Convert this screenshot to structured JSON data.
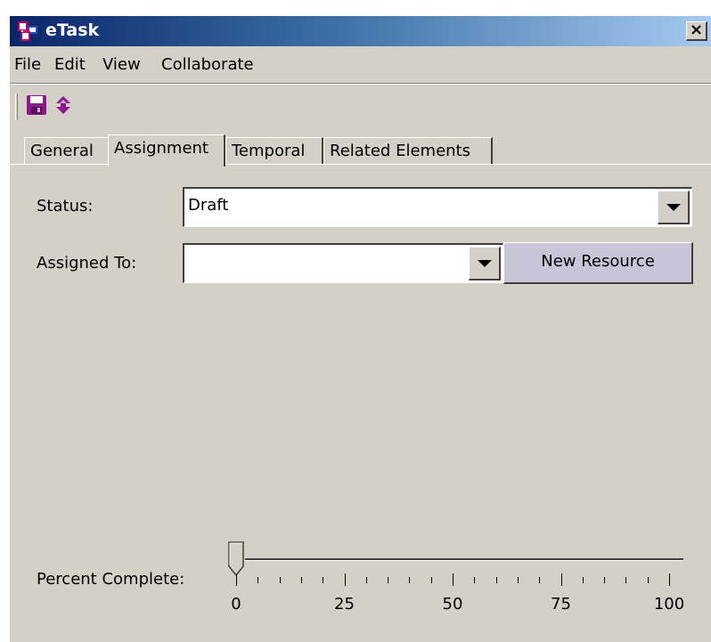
{
  "window": {
    "title": "eTask",
    "close_glyph": "×"
  },
  "menu": {
    "items": [
      {
        "label": "File"
      },
      {
        "label": "Edit"
      },
      {
        "label": "View"
      },
      {
        "label": "Collaborate"
      }
    ]
  },
  "toolbar": {
    "buttons": [
      {
        "icon": "save-icon"
      },
      {
        "icon": "refresh-icon"
      }
    ]
  },
  "tabs": [
    {
      "label": "General",
      "active": false
    },
    {
      "label": "Assignment",
      "active": true
    },
    {
      "label": "Temporal",
      "active": false
    },
    {
      "label": "Related Elements",
      "active": false
    }
  ],
  "form": {
    "status_label": "Status:",
    "status_value": "Draft",
    "assigned_label": "Assigned To:",
    "assigned_value": "",
    "new_resource_label": "New Resource"
  },
  "percent_complete": {
    "label": "Percent Complete:",
    "value": 0,
    "min": 0,
    "max": 100,
    "major_labels": [
      "0",
      "25",
      "50",
      "75",
      "100"
    ]
  },
  "colors": {
    "title_gradient_start": "#0a246a",
    "title_gradient_end": "#a6caf0",
    "window_bg": "#d4d0c8",
    "button_bg": "#c8c5d8",
    "icon_purple": "#8b1a8b"
  }
}
